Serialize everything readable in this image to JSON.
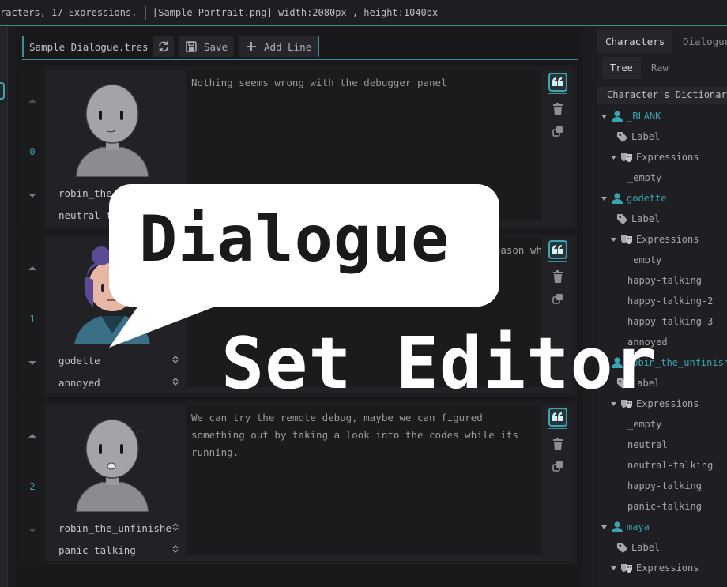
{
  "status_bar": {
    "left_text": "racters, 17 Expressions,",
    "right_text": "[Sample Portrait.png] width:2080px , height:1040px"
  },
  "toolbar": {
    "file_name": "Sample Dialogue.tres",
    "save_label": "Save",
    "add_line_label": "Add Line"
  },
  "lines": [
    {
      "index": "0",
      "text": "Nothing seems wrong with the debugger panel",
      "character": "robin_the_unfinishe",
      "expression": "neutral-talking"
    },
    {
      "index": "1",
      "text": "Turns out we've got a trailing line... that's the reason why these npc",
      "character": "godette",
      "expression": "annoyed"
    },
    {
      "index": "2",
      "text": "We can try the remote debug, maybe we can figured something out by taking a look into the codes while its running.",
      "character": "robin_the_unfinishe",
      "expression": "panic-talking"
    }
  ],
  "right_panel": {
    "tabs": [
      "Characters",
      "Dialogue"
    ],
    "subtabs": [
      "Tree",
      "Raw"
    ],
    "dictionary_header": "Character's Dictionary",
    "tree": [
      {
        "kind": "char",
        "label": "_BLANK"
      },
      {
        "kind": "label",
        "label": "Label"
      },
      {
        "kind": "expr-group",
        "label": "Expressions"
      },
      {
        "kind": "expr",
        "label": "_empty"
      },
      {
        "kind": "char",
        "label": "godette"
      },
      {
        "kind": "label",
        "label": "Label"
      },
      {
        "kind": "expr-group",
        "label": "Expressions"
      },
      {
        "kind": "expr",
        "label": "_empty"
      },
      {
        "kind": "expr",
        "label": "happy-talking"
      },
      {
        "kind": "expr",
        "label": "happy-talking-2"
      },
      {
        "kind": "expr",
        "label": "happy-talking-3"
      },
      {
        "kind": "expr",
        "label": "annoyed"
      },
      {
        "kind": "char",
        "label": "robin_the_unfinished"
      },
      {
        "kind": "label",
        "label": "Label"
      },
      {
        "kind": "expr-group",
        "label": "Expressions"
      },
      {
        "kind": "expr",
        "label": "_empty"
      },
      {
        "kind": "expr",
        "label": "neutral"
      },
      {
        "kind": "expr",
        "label": "neutral-talking"
      },
      {
        "kind": "expr",
        "label": "happy-talking"
      },
      {
        "kind": "expr",
        "label": "panic-talking"
      },
      {
        "kind": "char",
        "label": "maya"
      },
      {
        "kind": "label",
        "label": "Label"
      },
      {
        "kind": "expr-group",
        "label": "Expressions"
      }
    ]
  },
  "banner": {
    "line1": "Dialogue",
    "line2": "Set Editor"
  },
  "colors": {
    "accent": "#3aa5ae",
    "background": "#1d1d21"
  }
}
